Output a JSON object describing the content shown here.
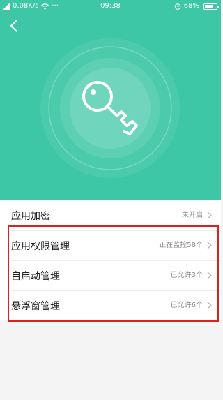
{
  "status_bar": {
    "network_speed": "0.08K/s",
    "more": "···",
    "time": "09:38",
    "battery": "68%",
    "battery_level": 0.68
  },
  "header": {
    "back_icon": "chevron-left-icon",
    "hero_icon": "key-icon"
  },
  "colors": {
    "accent": "#3ec7a6",
    "highlight": "#e02020"
  },
  "items": [
    {
      "label": "应用加密",
      "status": "未开启"
    },
    {
      "label": "应用权限管理",
      "status": "正在监控58个"
    },
    {
      "label": "自启动管理",
      "status": "已允许3个"
    },
    {
      "label": "悬浮窗管理",
      "status": "已允许6个"
    }
  ]
}
